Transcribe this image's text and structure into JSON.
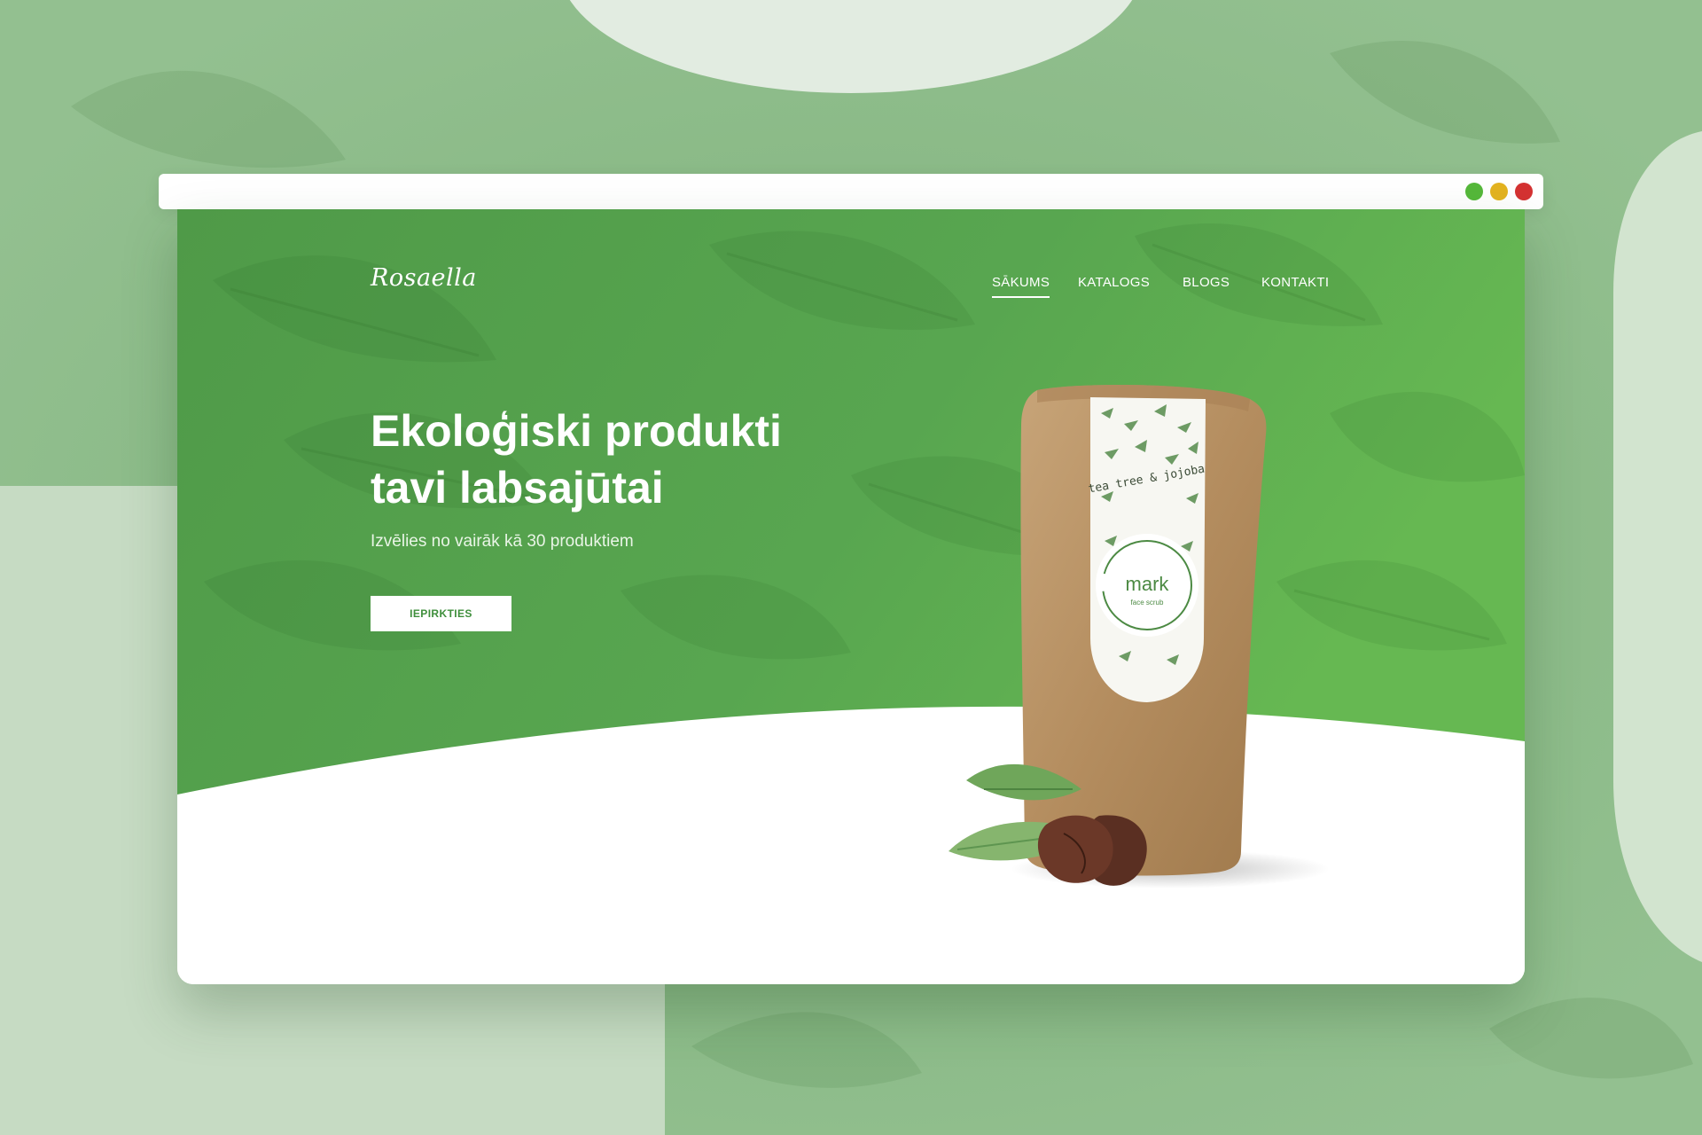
{
  "site": {
    "logo": "Rosaella",
    "nav": [
      {
        "label": "SĀKUMS",
        "active": true
      },
      {
        "label": "KATALOGS",
        "active": false
      },
      {
        "label": "BLOGS",
        "active": false
      },
      {
        "label": "KONTAKTI",
        "active": false
      }
    ]
  },
  "hero": {
    "headline_line1": "Ekoloģiski produkti",
    "headline_line2": "tavi labsajūtai",
    "subtitle": "Izvēlies no vairāk kā 30 produktiem",
    "cta_label": "IEPIRKTIES"
  },
  "product": {
    "label_top": "tea tree & jojoba",
    "brand": "mark",
    "descriptor": "face scrub"
  },
  "window_controls": {
    "colors": [
      "#55b83a",
      "#e3b320",
      "#d43232"
    ]
  },
  "colors": {
    "brand_green": "#5aa84f",
    "background_green": "#8dbb8a",
    "button_text": "#3f8f3c"
  }
}
